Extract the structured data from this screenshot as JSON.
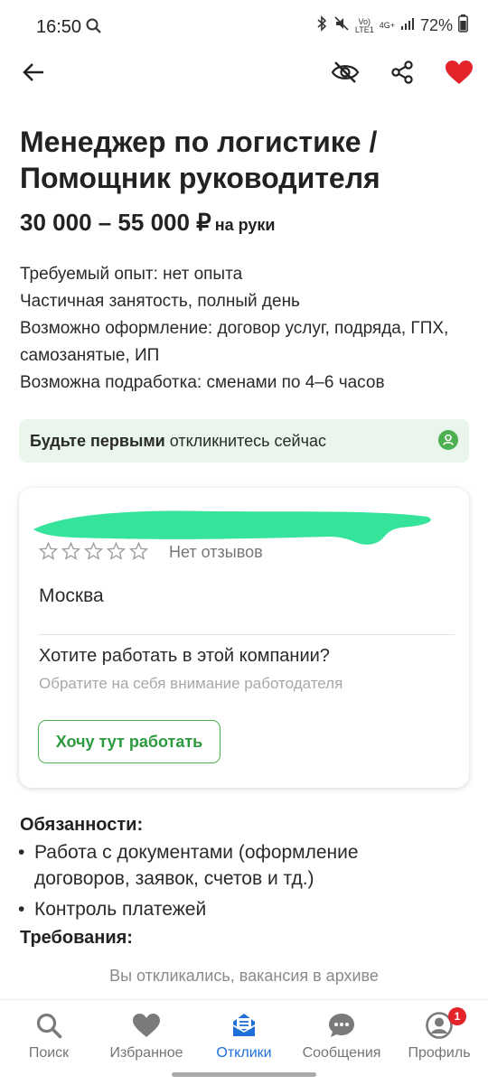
{
  "status": {
    "time": "16:50",
    "network_top": "Vo)",
    "network_bottom": "LTE1",
    "signal_top": "4G+",
    "battery": "72%"
  },
  "toolbar": {
    "back_icon": "arrow-left-icon",
    "hide_icon": "eye-off-icon",
    "share_icon": "share-icon",
    "favorite_icon": "heart-filled-icon",
    "favorite_color": "#e4242b"
  },
  "vacancy": {
    "title": "Менеджер по логистике / Помощник руководителя",
    "salary": "30 000 – 55 000 ₽",
    "salary_suffix": "на руки",
    "info": [
      "Требуемый опыт: нет опыта",
      "Частичная занятость, полный день",
      "Возможно оформление: договор услуг, подряда, ГПХ, самозанятые, ИП",
      "Возможна подработка: сменами по 4–6 часов"
    ]
  },
  "banner": {
    "bold": "Будьте первыми",
    "rest": "откликнитесь сейчас",
    "background": "#eaf6ec"
  },
  "company": {
    "reviews_text": "Нет отзывов",
    "rating": 0,
    "city": "Москва",
    "want_title": "Хотите работать в этой компании?",
    "want_subtitle": "Обратите на себя внимание работодателя",
    "want_button": "Хочу тут работать"
  },
  "duties": {
    "title": "Обязанности:",
    "items": [
      "Работа с документами (оформление договоров, заявок, счетов и тд.)",
      "Контроль платежей"
    ]
  },
  "requirements": {
    "title": "Требования:"
  },
  "archived_note": "Вы откликались, вакансия в архиве",
  "bottom_nav": {
    "items": [
      {
        "label": "Поиск",
        "icon": "search-icon"
      },
      {
        "label": "Избранное",
        "icon": "heart-icon"
      },
      {
        "label": "Отклики",
        "icon": "responses-icon"
      },
      {
        "label": "Сообщения",
        "icon": "chat-icon"
      },
      {
        "label": "Профиль",
        "icon": "profile-icon",
        "badge": "1"
      }
    ],
    "active_color": "#1e6fd9"
  }
}
